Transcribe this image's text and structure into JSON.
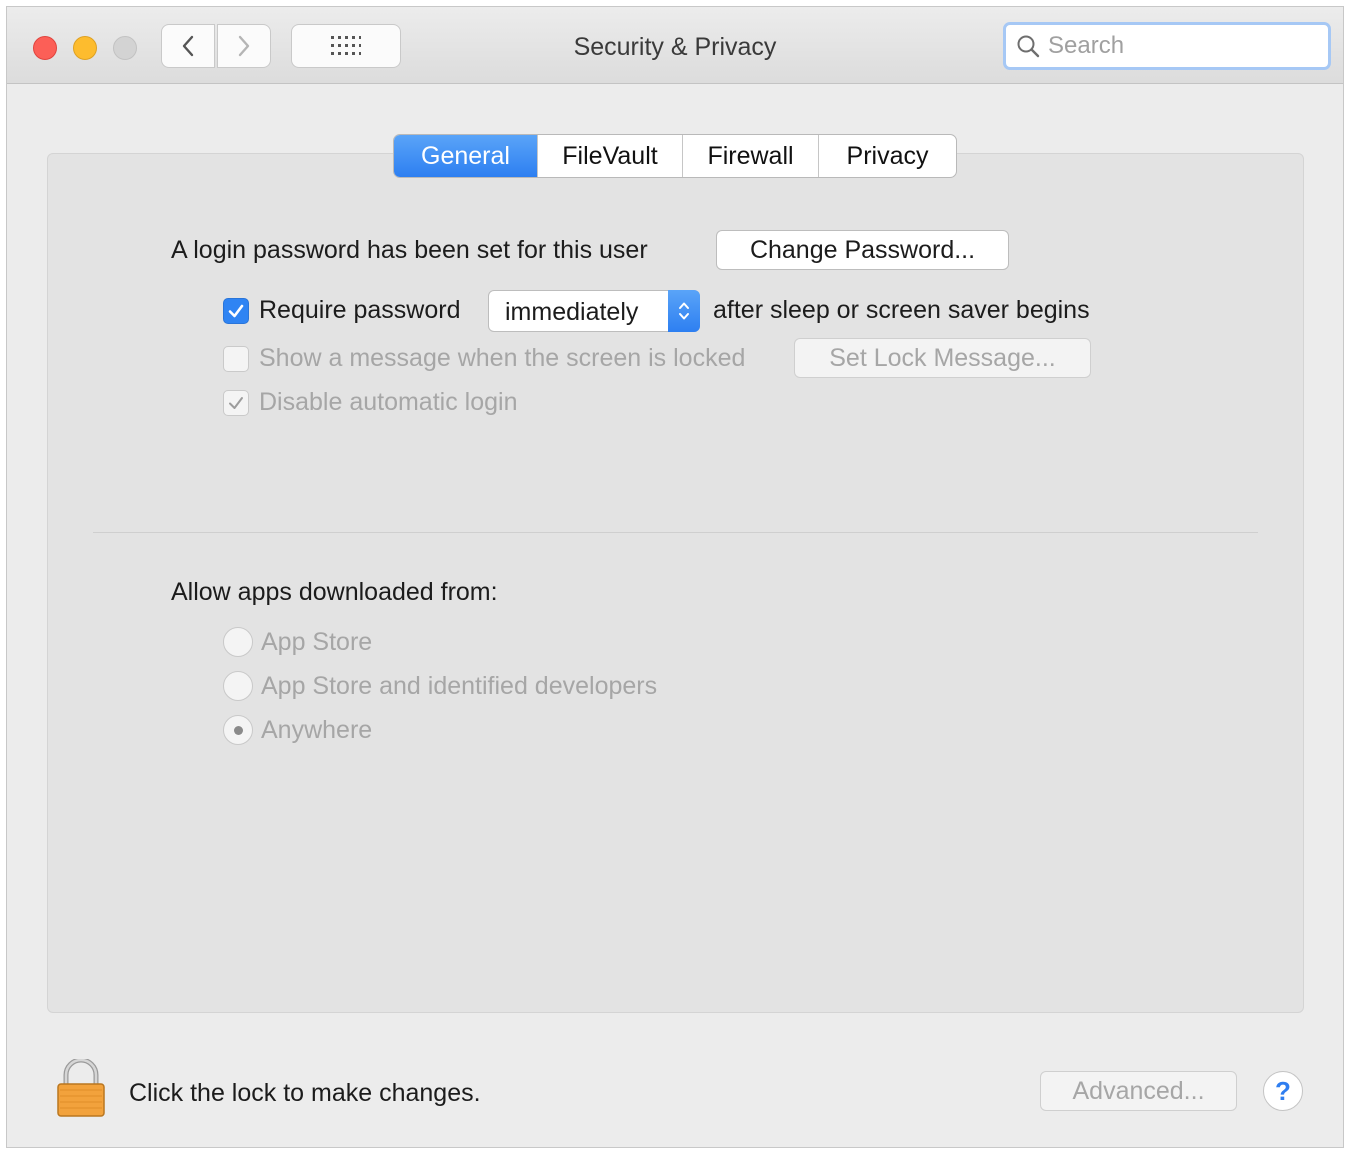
{
  "window": {
    "title": "Security & Privacy",
    "search_placeholder": "Search"
  },
  "tabs": [
    {
      "label": "General",
      "active": true
    },
    {
      "label": "FileVault",
      "active": false
    },
    {
      "label": "Firewall",
      "active": false
    },
    {
      "label": "Privacy",
      "active": false
    }
  ],
  "general": {
    "login_text": "A login password has been set for this user",
    "change_password_label": "Change Password...",
    "require_password": {
      "checked": true,
      "label": "Require password",
      "select_value": "immediately",
      "suffix": "after sleep or screen saver begins"
    },
    "show_message": {
      "checked": false,
      "enabled": false,
      "label": "Show a message when the screen is locked",
      "button_label": "Set Lock Message..."
    },
    "disable_autologin": {
      "checked": true,
      "enabled": false,
      "label": "Disable automatic login"
    }
  },
  "downloads": {
    "heading": "Allow apps downloaded from:",
    "options": [
      {
        "label": "App Store",
        "selected": false
      },
      {
        "label": "App Store and identified developers",
        "selected": false
      },
      {
        "label": "Anywhere",
        "selected": true
      }
    ]
  },
  "footer": {
    "lock_text": "Click the lock to make changes.",
    "advanced_label": "Advanced...",
    "help_label": "?"
  },
  "colors": {
    "accent": "#2f84f3",
    "close": "#fc5f57",
    "minimize": "#fdbc2e",
    "lock_body": "#f2a23c"
  }
}
